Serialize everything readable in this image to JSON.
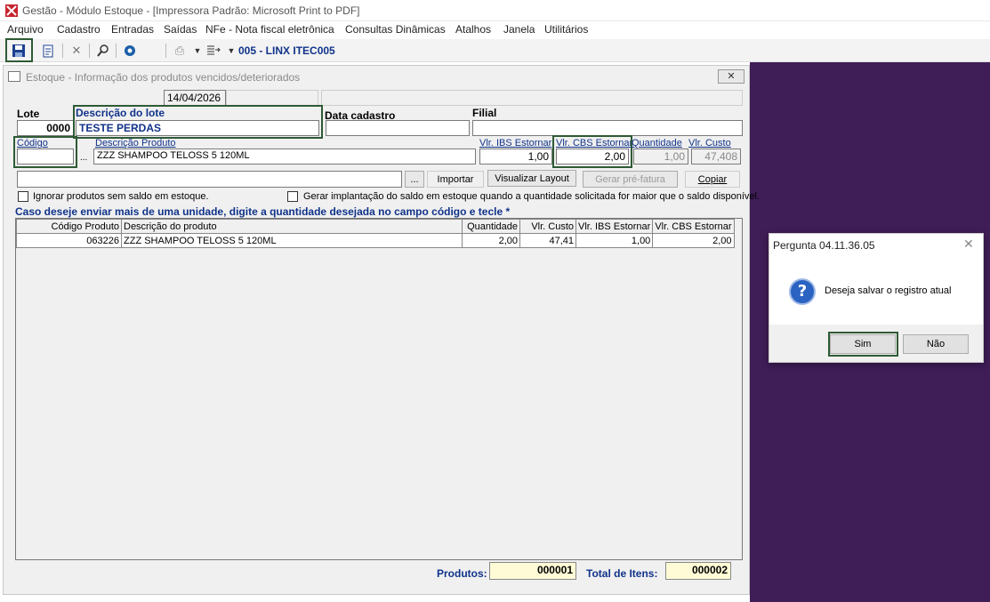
{
  "app": {
    "title": "Gestão  - Módulo Estoque - [Impressora Padrão: Microsoft Print to PDF]",
    "brand_color": "#c8242f"
  },
  "menu": [
    "Arquivo",
    "Cadastro",
    "Entradas",
    "Saídas",
    "NFe - Nota fiscal eletrônica",
    "Consultas Dinâmicas",
    "Atalhos",
    "Janela",
    "Utilitários"
  ],
  "toolbar": {
    "company": "005 - LINX ITEC005",
    "icons": [
      "save-icon",
      "new-document-icon",
      "delete-icon",
      "search-icon",
      "info-icon",
      "print-icon",
      "export-icon"
    ]
  },
  "form": {
    "window_title": "Estoque - Informação dos produtos vencidos/deteriorados",
    "date": "14/04/2026",
    "lote_label": "Lote",
    "lote_value": "0000",
    "descricao_lote_label": "Descrição do lote",
    "descricao_lote_value": "TESTE PERDAS",
    "data_cadastro_label": "Data cadastro",
    "data_cadastro_value": "",
    "filial_label": "Filial",
    "filial_value": "",
    "codigo_label": "Código",
    "codigo_value": "",
    "descricao_produto_label": "Descrição  Produto",
    "descricao_produto_value": "ZZZ SHAMPOO TELOSS 5 120ML",
    "vlr_ibs_label": "Vlr. IBS Estornar",
    "vlr_ibs_value": "1,00",
    "vlr_cbs_label": "Vlr. CBS Estornar",
    "vlr_cbs_value": "2,00",
    "quantidade_label": "Quantidade",
    "quantidade_value": "1,00",
    "vlr_custo_label": "Vlr. Custo",
    "vlr_custo_value": "47,408",
    "file_value": "",
    "browse_label": "...",
    "importar_label": "Importar",
    "visualizar_label": "Visualizar Layout",
    "gerar_label": "Gerar pré-fatura",
    "copiar_label": "Copiar",
    "ignorar_label": "Ignorar produtos sem saldo em estoque.",
    "gerar_implantacao_label": "Gerar implantação do saldo em estoque quando a quantidade solicitada for maior que o saldo disponível.",
    "instrucao": "Caso deseje enviar mais de uma unidade, digite a quantidade desejada no campo código e tecle *",
    "codigo_browse": "..."
  },
  "grid": {
    "columns": [
      "Código Produto",
      "Descrição do produto",
      "Quantidade",
      "Vlr. Custo",
      "Vlr. IBS Estornar",
      "Vlr. CBS Estornar"
    ],
    "rows": [
      [
        "063226",
        "ZZZ SHAMPOO TELOSS 5 120ML",
        "2,00",
        "47,41",
        "1,00",
        "2,00"
      ]
    ]
  },
  "summary": {
    "produtos_label": "Produtos:",
    "produtos_value": "000001",
    "total_label": "Total de Itens:",
    "total_value": "000002"
  },
  "dialog": {
    "title": "Pergunta 04.11.36.05",
    "message": "Deseja salvar o registro atual",
    "yes_label": "Sim",
    "no_label": "Não"
  },
  "colors": {
    "mdi_background": "#3f1d57",
    "highlight": "#2e5a35",
    "label_blue": "#10338a"
  }
}
